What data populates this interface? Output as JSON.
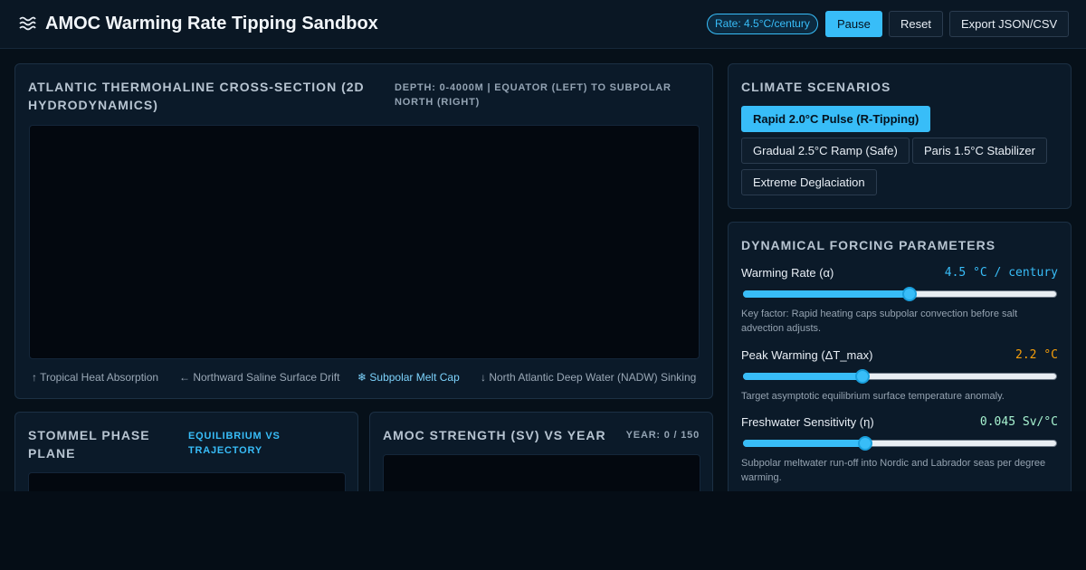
{
  "header": {
    "title": "AMOC Warming Rate Tipping Sandbox",
    "rate_pill": "Rate: 4.5°C/century",
    "pause_label": "Pause",
    "reset_label": "Reset",
    "export_label": "Export JSON/CSV"
  },
  "cross_section": {
    "title": "ATLANTIC THERMOHALINE CROSS-SECTION (2D HYDRODYNAMICS)",
    "subtitle": "DEPTH: 0-4000M | EQUATOR (LEFT) TO SUBPOLAR NORTH (RIGHT)",
    "legend": [
      "↑ Tropical Heat Absorption",
      "← Northward Saline Surface Drift",
      "❄ Subpolar Melt Cap",
      "↓ North Atlantic Deep Water (NADW) Sinking"
    ]
  },
  "stommel": {
    "title": "STOMMEL PHASE PLANE",
    "subtitle": "EQUILIBRIUM VS TRAJECTORY"
  },
  "amoc_strength": {
    "title": "AMOC STRENGTH (SV) VS YEAR",
    "subtitle": "YEAR: 0 / 150"
  },
  "scenarios": {
    "title": "CLIMATE SCENARIOS",
    "items": [
      "Rapid 2.0°C Pulse (R-Tipping)",
      "Gradual 2.5°C Ramp (Safe)",
      "Paris 1.5°C Stabilizer",
      "Extreme Deglaciation"
    ]
  },
  "parameters": {
    "title": "DYNAMICAL FORCING PARAMETERS",
    "warming_rate": {
      "label": "Warming Rate (α)",
      "value": "4.5 °C / century",
      "level": 0.53,
      "description": "Key factor: Rapid heating caps subpolar convection before salt advection adjusts."
    },
    "peak_warming": {
      "label": "Peak Warming (ΔT_max)",
      "value": "2.2 °C",
      "level": 0.38,
      "description": "Target asymptotic equilibrium surface temperature anomaly."
    },
    "freshwater": {
      "label": "Freshwater Sensitivity (η)",
      "value": "0.045 Sv/°C",
      "level": 0.39,
      "description": "Subpolar meltwater run-off into Nordic and Labrador seas per degree warming."
    }
  },
  "colors": {
    "accent": "#38bdf8",
    "peak_value": "#f59e0b",
    "freshwater_value": "#a7f3d0"
  }
}
